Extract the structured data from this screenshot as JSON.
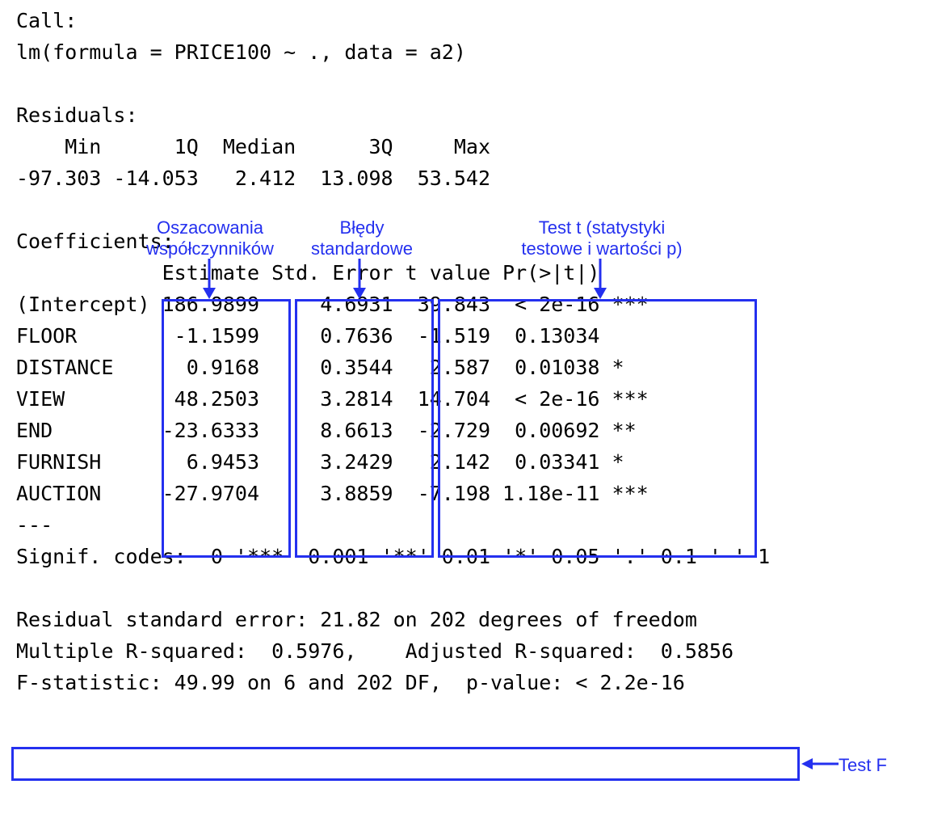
{
  "call_label": "Call:",
  "call_formula": "lm(formula = PRICE100 ~ ., data = a2)",
  "residuals_label": "Residuals:",
  "residuals_header": "    Min      1Q  Median      3Q     Max ",
  "residuals_values": "-97.303 -14.053   2.412  13.098  53.542 ",
  "coefficients_label": "Coefficients:",
  "coef_header": "            Estimate Std. Error t value Pr(>|t|)    ",
  "coef_rows": [
    "(Intercept) 186.9899     4.6931  39.843  < 2e-16 ***",
    "FLOOR        -1.1599     0.7636  -1.519  0.13034    ",
    "DISTANCE      0.9168     0.3544   2.587  0.01038 *  ",
    "VIEW         48.2503     3.2814  14.704  < 2e-16 ***",
    "END         -23.6333     8.6613  -2.729  0.00692 ** ",
    "FURNISH       6.9453     3.2429   2.142  0.03341 *  ",
    "AUCTION     -27.9704     3.8859  -7.198 1.18e-11 ***"
  ],
  "dashes": "---",
  "signif_codes": "Signif. codes:  0 '***' 0.001 '**' 0.01 '*' 0.05 '.' 0.1 ' ' 1",
  "rse_line": "Residual standard error: 21.82 on 202 degrees of freedom",
  "rsq_line": "Multiple R-squared:  0.5976,\tAdjusted R-squared:  0.5856 ",
  "fstat_line": "F-statistic: 49.99 on 6 and 202 DF,  p-value: < 2.2e-16",
  "annotations": {
    "estimate_label_l1": "Oszacowania",
    "estimate_label_l2": "współczynników",
    "stderr_label_l1": "Błędy",
    "stderr_label_l2": "standardowe",
    "ttest_label_l1": "Test t (statystyki",
    "ttest_label_l2": "testowe i wartości p)",
    "ftest_label": "Test F"
  },
  "chart_data": {
    "type": "table",
    "title": "lm(formula = PRICE100 ~ ., data = a2)",
    "residuals": {
      "Min": -97.303,
      "1Q": -14.053,
      "Median": 2.412,
      "3Q": 13.098,
      "Max": 53.542
    },
    "coefficients": [
      {
        "term": "(Intercept)",
        "Estimate": 186.9899,
        "StdError": 4.6931,
        "tvalue": 39.843,
        "Pr": "< 2e-16",
        "signif": "***"
      },
      {
        "term": "FLOOR",
        "Estimate": -1.1599,
        "StdError": 0.7636,
        "tvalue": -1.519,
        "Pr": "0.13034",
        "signif": ""
      },
      {
        "term": "DISTANCE",
        "Estimate": 0.9168,
        "StdError": 0.3544,
        "tvalue": 2.587,
        "Pr": "0.01038",
        "signif": "*"
      },
      {
        "term": "VIEW",
        "Estimate": 48.2503,
        "StdError": 3.2814,
        "tvalue": 14.704,
        "Pr": "< 2e-16",
        "signif": "***"
      },
      {
        "term": "END",
        "Estimate": -23.6333,
        "StdError": 8.6613,
        "tvalue": -2.729,
        "Pr": "0.00692",
        "signif": "**"
      },
      {
        "term": "FURNISH",
        "Estimate": 6.9453,
        "StdError": 3.2429,
        "tvalue": 2.142,
        "Pr": "0.03341",
        "signif": "*"
      },
      {
        "term": "AUCTION",
        "Estimate": -27.9704,
        "StdError": 3.8859,
        "tvalue": -7.198,
        "Pr": "1.18e-11",
        "signif": "***"
      }
    ],
    "signif_codes": "0 '***' 0.001 '**' 0.01 '*' 0.05 '.' 0.1 ' ' 1",
    "residual_standard_error": 21.82,
    "df_residual": 202,
    "multiple_r_squared": 0.5976,
    "adjusted_r_squared": 0.5856,
    "f_statistic": 49.99,
    "f_df1": 6,
    "f_df2": 202,
    "f_pvalue": "< 2.2e-16"
  }
}
